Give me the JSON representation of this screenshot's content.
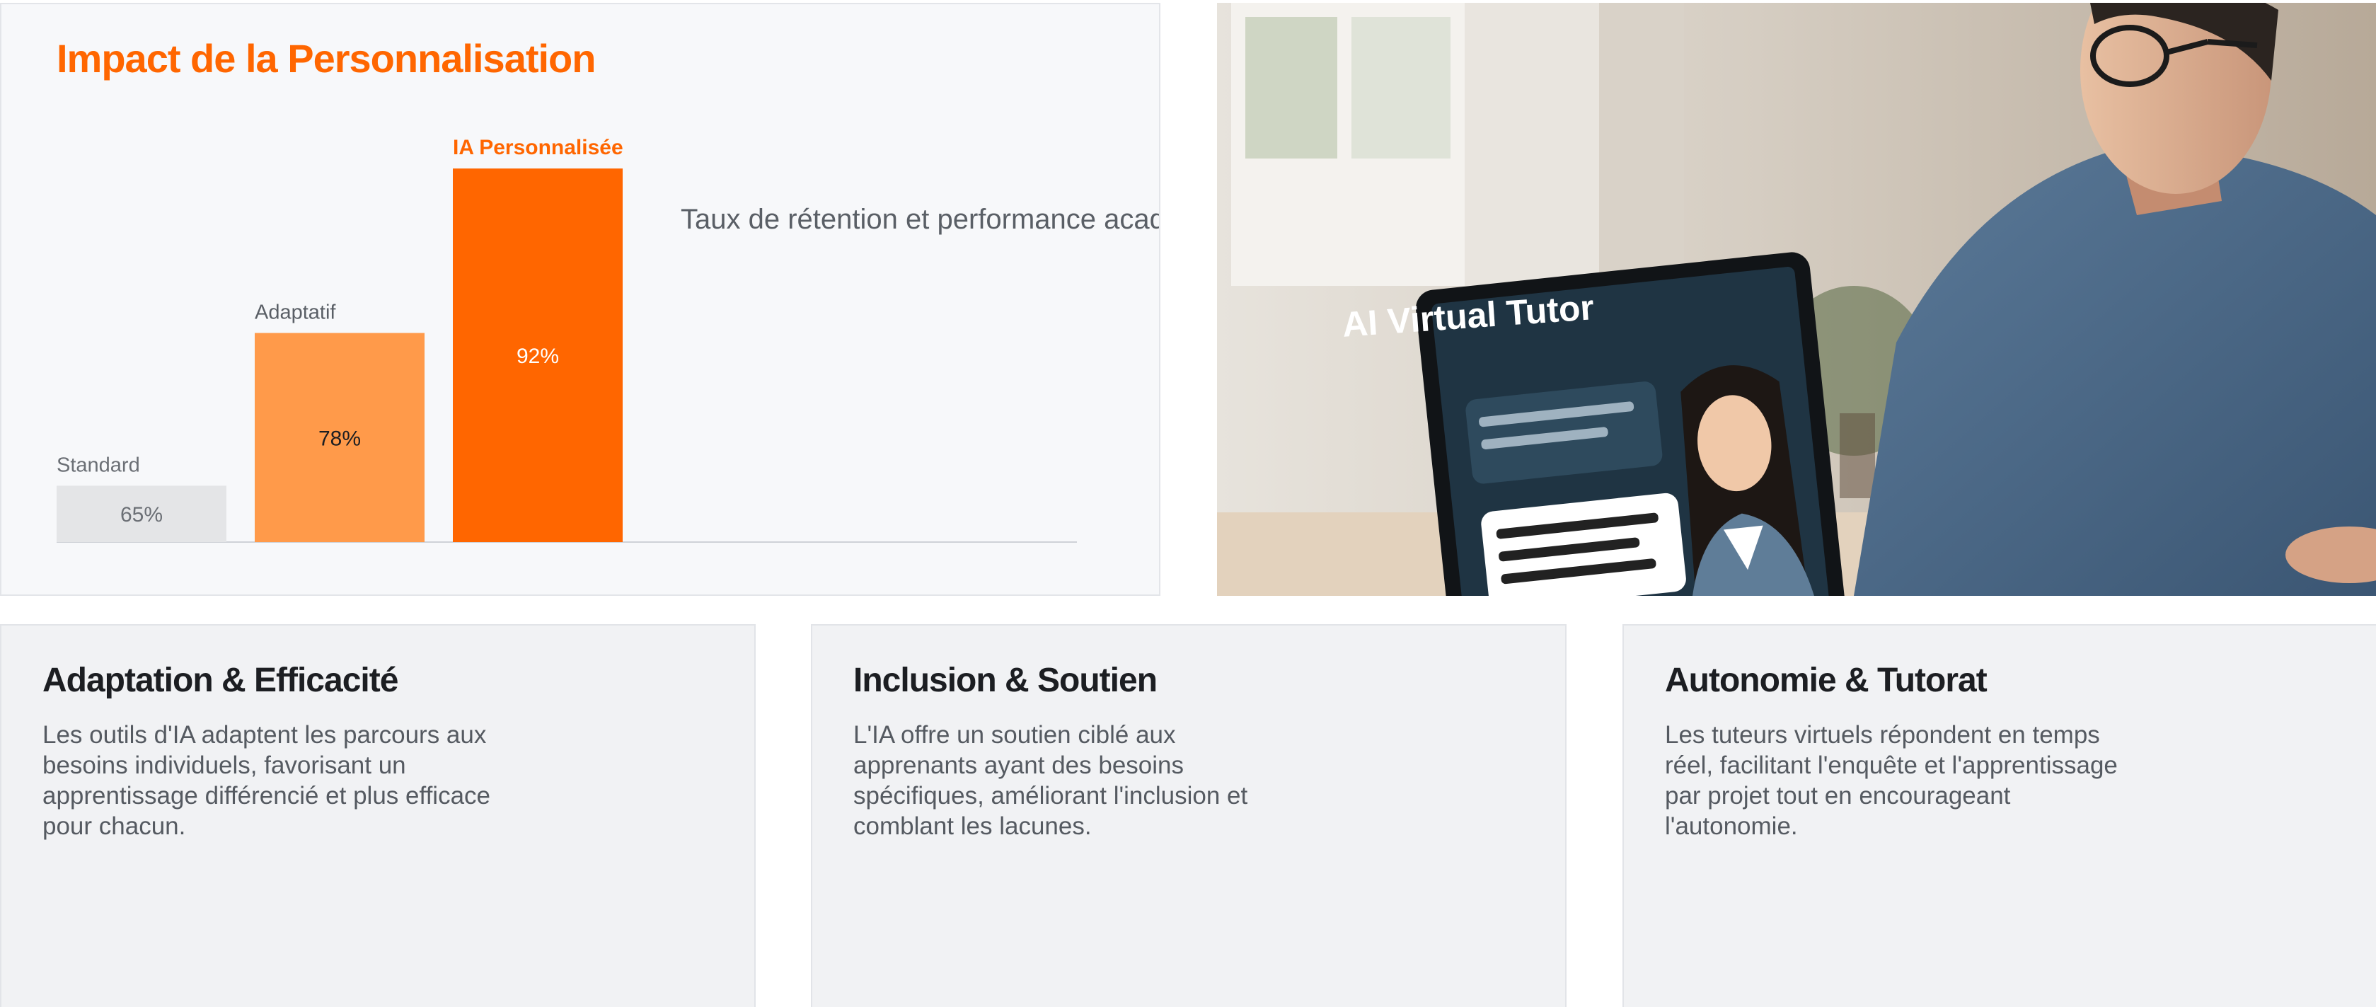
{
  "chart": {
    "title": "Impact de la Personnalisation",
    "subtitle": "Taux de rétention et performance académi"
  },
  "chart_data": {
    "type": "bar",
    "title": "Impact de la Personnalisation",
    "subtitle": "Taux de rétention et performance académi",
    "categories": [
      "Standard",
      "Adaptatif",
      "IA Personnalisée"
    ],
    "values": [
      65,
      78,
      92
    ],
    "value_labels": [
      "65%",
      "78%",
      "92%"
    ],
    "colors": [
      "#e4e5e7",
      "#ff9a4a",
      "#ff6600"
    ],
    "label_colors": [
      "#6b6f75",
      "#5a5f66",
      "#ff6600"
    ],
    "value_text_colors": [
      "#6b6f75",
      "#1c1e22",
      "#ffffff"
    ],
    "xlabel": "",
    "ylabel": "",
    "grid": false
  },
  "photo": {
    "screen_title": "AI Virtual Tutor"
  },
  "cards": [
    {
      "title": "Adaptation & Efficacité",
      "text": "Les outils d'IA adaptent les parcours aux besoins individuels, favorisant un apprentissage différencié et plus efficace pour chacun."
    },
    {
      "title": "Inclusion & Soutien",
      "text": "L'IA offre un soutien ciblé aux apprenants ayant des besoins spécifiques, améliorant l'inclusion et comblant les lacunes."
    },
    {
      "title": "Autonomie & Tutorat",
      "text": "Les tuteurs virtuels répondent en temps réel, facilitant l'enquête et l'apprentissage par projet tout en encourageant l'autonomie."
    }
  ],
  "colors": {
    "accent": "#ff6600",
    "accent_light": "#ff9a4a"
  }
}
